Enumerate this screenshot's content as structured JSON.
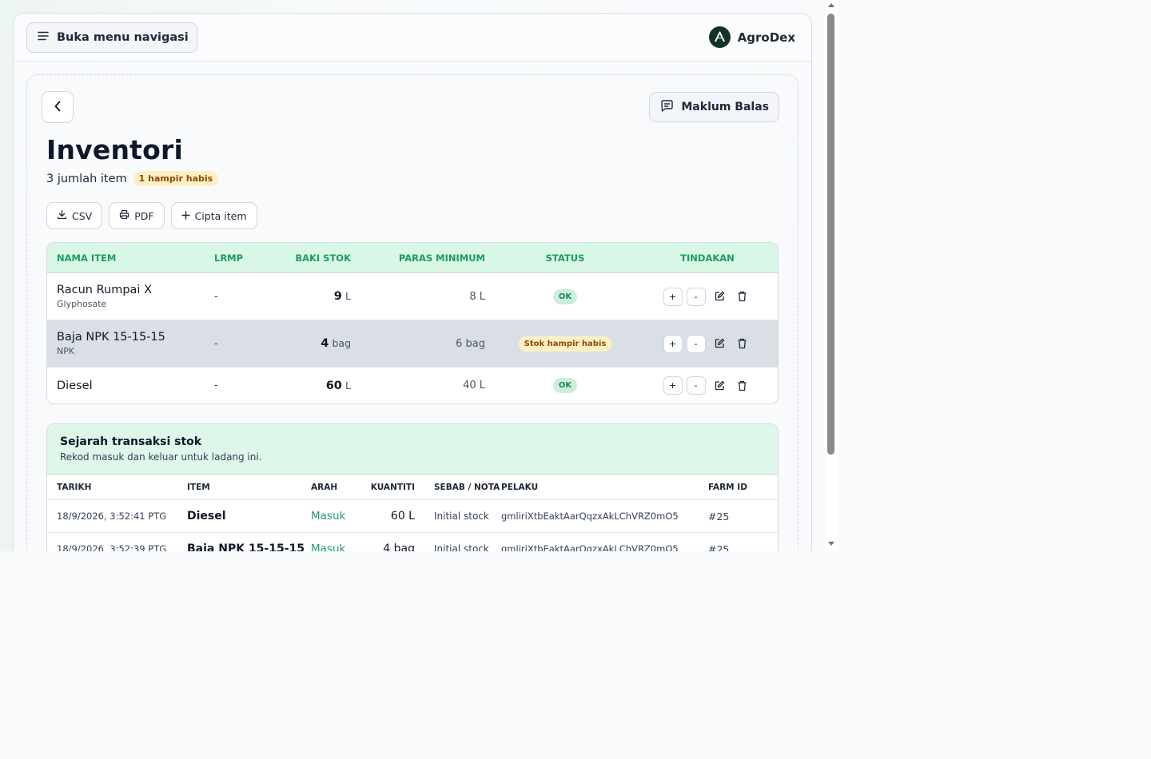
{
  "header": {
    "nav_button_label": "Buka menu navigasi",
    "brand_name": "AgroDex"
  },
  "page": {
    "feedback_label": "Maklum Balas",
    "title": "Inventori",
    "summary_text": "3 jumlah item",
    "low_badge": "1 hampir habis",
    "actions": {
      "csv": "CSV",
      "pdf": "PDF",
      "create": "Cipta item"
    }
  },
  "inventory": {
    "columns": [
      "NAMA ITEM",
      "LRMP",
      "BAKI STOK",
      "PARAS MINIMUM",
      "STATUS",
      "TINDAKAN"
    ],
    "rows": [
      {
        "name": "Racun Rumpai X",
        "sub": "Glyphosate",
        "lrmp": "-",
        "qty": "9",
        "unit": "L",
        "min": "8 L",
        "status": "OK",
        "low": false
      },
      {
        "name": "Baja NPK 15-15-15",
        "sub": "NPK",
        "lrmp": "-",
        "qty": "4",
        "unit": "bag",
        "min": "6 bag",
        "status": "Stok hampir habis",
        "low": true
      },
      {
        "name": "Diesel",
        "sub": "",
        "lrmp": "-",
        "qty": "60",
        "unit": "L",
        "min": "40 L",
        "status": "OK",
        "low": false
      }
    ],
    "row_action_plus": "+",
    "row_action_minus": "-"
  },
  "history": {
    "title": "Sejarah transaksi stok",
    "subtitle": "Rekod masuk dan keluar untuk ladang ini.",
    "columns": [
      "TARIKH",
      "ITEM",
      "ARAH",
      "KUANTITI",
      "SEBAB / NOTA",
      "PELAKU",
      "FARM ID"
    ],
    "rows": [
      {
        "date": "18/9/2026, 3:52:41 PTG",
        "item": "Diesel",
        "direction": "Masuk",
        "qty": "60 L",
        "note": "Initial stock",
        "actor": "gmliriXtbEaktAarQqzxAkLChVRZ0mO5",
        "farm": "#25"
      },
      {
        "date": "18/9/2026, 3:52:39 PTG",
        "item": "Baja NPK 15-15-15",
        "direction": "Masuk",
        "qty": "4 bag",
        "note": "Initial stock",
        "actor": "gmliriXtbEaktAarQqzxAkLChVRZ0mO5",
        "farm": "#25"
      }
    ]
  },
  "colors": {
    "accent_green": "#1e9b62",
    "header_green_bg": "#d9f7e7",
    "warn_bg": "#fdf0c4",
    "warn_text": "#8a4a0a"
  }
}
